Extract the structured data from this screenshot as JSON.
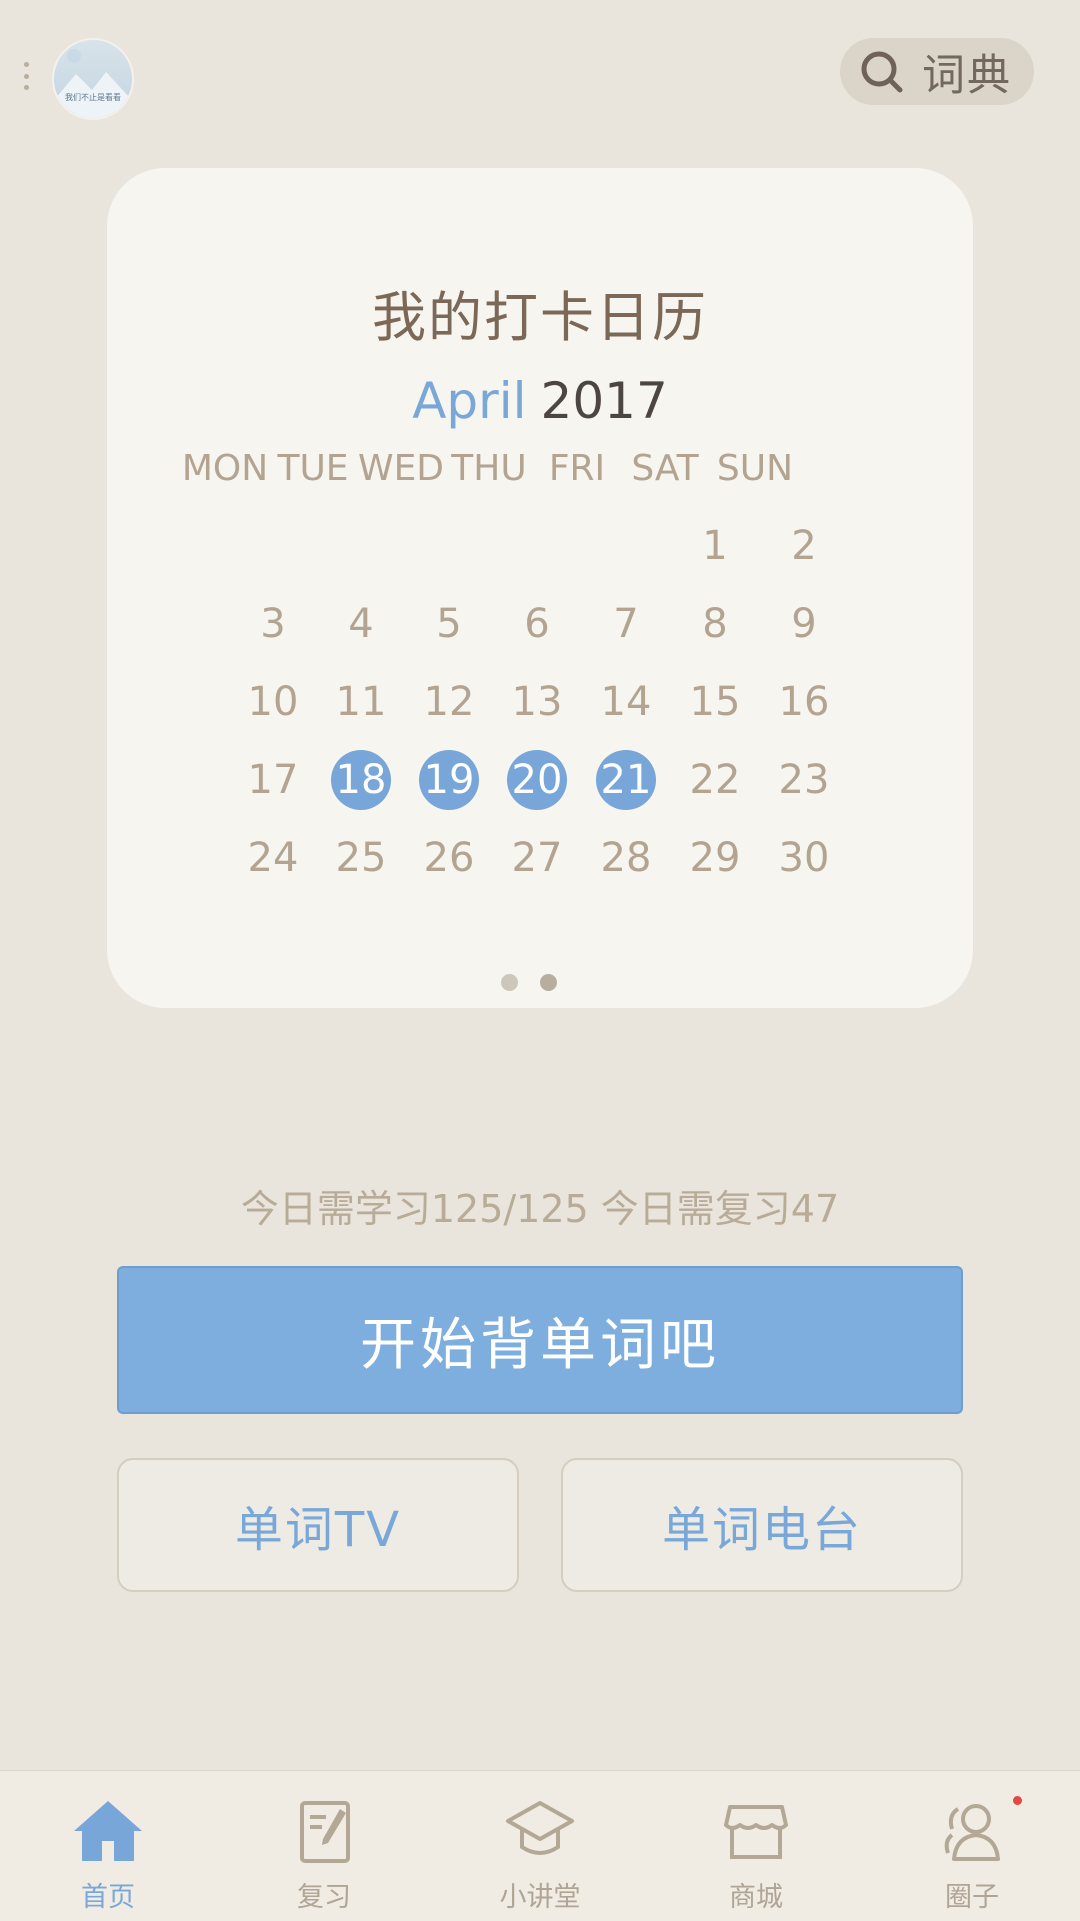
{
  "header": {
    "avatar_text": "我们不止是看看",
    "dictionary_label": "词典",
    "search_icon": "search-icon",
    "menu_icon": "more-vert-icon"
  },
  "calendar": {
    "title": "我的打卡日历",
    "month": "April",
    "year": "2017",
    "weekdays": [
      "MON",
      "TUE",
      "WED",
      "THU",
      "FRI",
      "SAT",
      "SUN"
    ],
    "first_weekday_index": 5,
    "days_in_month": 30,
    "checked_days": [
      18,
      19,
      20,
      21
    ],
    "pager": {
      "count": 2,
      "active": 1
    }
  },
  "summary": "今日需学习125/125 今日需复习47",
  "buttons": {
    "start": "开始背单词吧",
    "tv": "单词TV",
    "radio": "单词电台"
  },
  "nav": {
    "items": [
      {
        "label": "首页",
        "icon": "home-icon",
        "active": true
      },
      {
        "label": "复习",
        "icon": "review-notebook-icon",
        "active": false
      },
      {
        "label": "小讲堂",
        "icon": "graduation-cap-icon",
        "active": false
      },
      {
        "label": "商城",
        "icon": "store-icon",
        "active": false
      },
      {
        "label": "圈子",
        "icon": "community-users-icon",
        "active": false
      }
    ],
    "badge_on": "圈子"
  },
  "colors": {
    "accent": "#78a6d8",
    "background": "#e9e5dd",
    "card": "#f7f5f0",
    "muted_text": "#b2a491",
    "badge": "#e84545"
  }
}
